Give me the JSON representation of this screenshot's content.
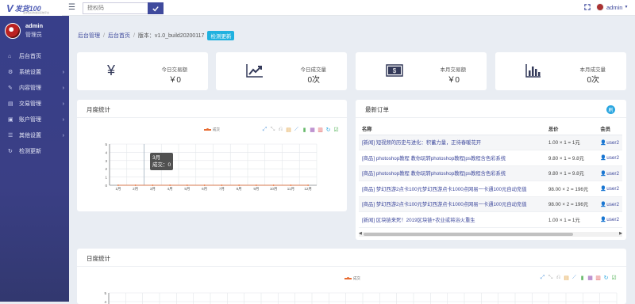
{
  "brand": {
    "logo_mark": "V",
    "logo_text": "发货100",
    "logo_sub": "爱你最好的发货系统平台"
  },
  "topbar": {
    "search_placeholder": "授权码",
    "user_name": "admin"
  },
  "sidebar": {
    "user_name": "admin",
    "user_role": "管理员",
    "items": [
      {
        "label": "后台首页",
        "icon": "home-icon",
        "has_arrow": false
      },
      {
        "label": "系统设置",
        "icon": "gear-icon",
        "has_arrow": true
      },
      {
        "label": "内容管理",
        "icon": "edit-icon",
        "has_arrow": true
      },
      {
        "label": "交易管理",
        "icon": "cart-icon",
        "has_arrow": true
      },
      {
        "label": "账户管理",
        "icon": "user-icon",
        "has_arrow": true
      },
      {
        "label": "其他设置",
        "icon": "sliders-icon",
        "has_arrow": true
      },
      {
        "label": "检测更新",
        "icon": "refresh-icon",
        "has_arrow": false
      }
    ]
  },
  "breadcrumb": {
    "item1": "后台管理",
    "item2": "后台首页",
    "version": "版本：v1.0_build20200117",
    "check_update": "检测更新"
  },
  "stats": [
    {
      "label": "今日交易额",
      "value": "￥0",
      "icon": "yen-icon"
    },
    {
      "label": "今日成交量",
      "value": "0次",
      "icon": "trend-icon"
    },
    {
      "label": "本月交易额",
      "value": "￥0",
      "icon": "cash-icon"
    },
    {
      "label": "本月成交量",
      "value": "0次",
      "icon": "bar-chart-icon"
    }
  ],
  "monthly": {
    "title": "月度统计",
    "tooltip_month": "3月",
    "tooltip_value": "成交：0"
  },
  "daily": {
    "title": "日度统计"
  },
  "orders": {
    "title": "最新订单",
    "refresh_badge": "刷",
    "columns": [
      "名称",
      "总价",
      "会员"
    ],
    "rows": [
      {
        "name": "[新闻] 短视频的历史与进化：积蓄力量，正待春暖花开",
        "total": "1.00 × 1 = 1元",
        "member": "user2"
      },
      {
        "name": "[商品] photoshop教程 教你玩转photoshop教程|ps教程含色彩系统",
        "total": "9.80 × 1 = 9.8元",
        "member": "user2"
      },
      {
        "name": "[商品] photoshop教程 教你玩转photoshop教程|ps教程含色彩系统",
        "total": "9.80 × 1 = 9.8元",
        "member": "user2"
      },
      {
        "name": "[商品] 梦幻西游2点卡100元梦幻西游点卡1000点网易一卡通100元自动充值",
        "total": "98.00 × 2 = 196元",
        "member": "user2"
      },
      {
        "name": "[商品] 梦幻西游2点卡100元梦幻西游点卡1000点网易一卡通100元自动充值",
        "total": "98.00 × 2 = 196元",
        "member": "user2"
      },
      {
        "name": "[新闻] 区块链来死！2019区块链+农业或将浴火重生",
        "total": "1.00 × 1 = 1元",
        "member": "user2"
      }
    ]
  },
  "chart_data": [
    {
      "type": "line",
      "series": [
        {
          "name": "成交",
          "values": [
            0,
            0,
            0,
            0,
            0,
            0,
            0,
            0,
            0,
            0,
            0,
            0
          ]
        }
      ],
      "categories": [
        "1月",
        "2月",
        "3月",
        "4月",
        "5月",
        "6月",
        "7月",
        "8月",
        "9月",
        "10月",
        "11月",
        "12月"
      ],
      "y_ticks": [
        0,
        1,
        2,
        3,
        4,
        5
      ],
      "ylim": [
        0,
        5
      ],
      "grid": true,
      "legend": "top"
    },
    {
      "type": "line",
      "series": [
        {
          "name": "成交",
          "values": []
        }
      ],
      "y_ticks": [
        4,
        5
      ],
      "grid": true,
      "legend": "top"
    }
  ],
  "colors": {
    "sidebar": "#383f8a",
    "accent": "#3f4a9d",
    "series": "#e86d33",
    "badge": "#20b1df"
  }
}
